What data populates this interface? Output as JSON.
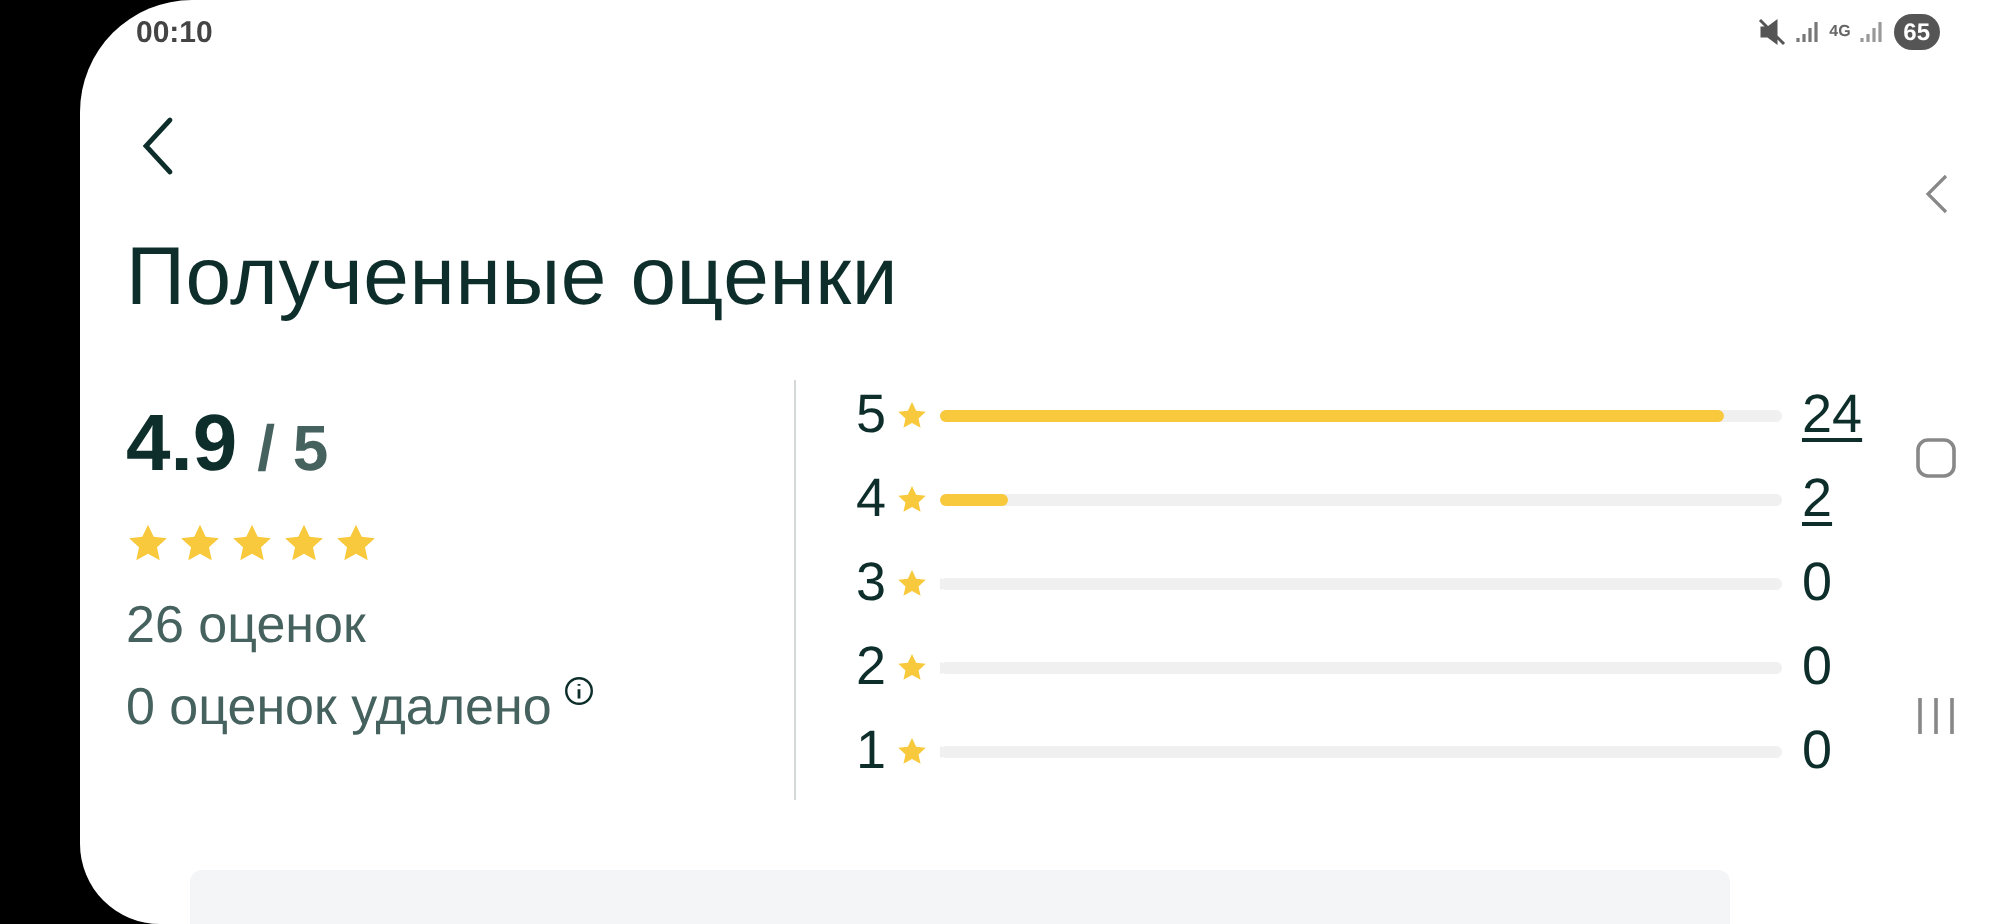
{
  "status_bar": {
    "time": "00:10",
    "network": "4G",
    "battery": "65"
  },
  "header": {
    "title": "Полученные оценки"
  },
  "summary": {
    "score": "4.9",
    "out_of": "/ 5",
    "stars": 5,
    "count": "26 оценок",
    "removed": "0 оценок удалено"
  },
  "distribution": [
    {
      "grade": "5",
      "level": 0.93,
      "count": "24",
      "linked": true
    },
    {
      "grade": "4",
      "level": 0.08,
      "count": "2",
      "linked": true
    },
    {
      "grade": "3",
      "level": 0,
      "count": "0",
      "linked": false
    },
    {
      "grade": "2",
      "level": 0,
      "count": "0",
      "linked": false
    },
    {
      "grade": "1",
      "level": 0,
      "count": "0",
      "linked": false
    }
  ]
}
